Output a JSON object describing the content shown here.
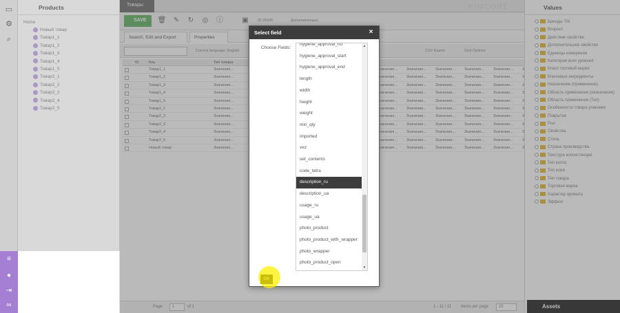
{
  "left_panel": {
    "title": "Products",
    "home": "Home",
    "items": [
      "Новый товар",
      "Товар1_1",
      "Товар1_2",
      "Товар1_3",
      "Товар1_4",
      "Товар1_5",
      "Товар2_1",
      "Товар2_2",
      "Товар2_3",
      "Товар2_4",
      "Товар2_5"
    ]
  },
  "tab": {
    "label": "Товары"
  },
  "toolbar": {
    "save_label": "SAVE",
    "id_text": "ID 25435",
    "variant_label": "Дополнительно"
  },
  "subtabs": {
    "search": "Search, Edit and Export",
    "properties": "Properties"
  },
  "grid_toolbar": {
    "language_label": "Current language: English",
    "csv_export": "CSV Export",
    "grid_options": "Grid Options"
  },
  "grid": {
    "headers": [
      "ID",
      "Key",
      "Тип товара"
    ],
    "rows": [
      {
        "key": "Товар1_1",
        "val": "Значение..."
      },
      {
        "key": "Товар1_2",
        "val": "Значение..."
      },
      {
        "key": "Товар1_3",
        "val": "Значение..."
      },
      {
        "key": "Товар1_4",
        "val": "Значение..."
      },
      {
        "key": "Товар1_5",
        "val": "Значение..."
      },
      {
        "key": "Товар2_1",
        "val": "Значение..."
      },
      {
        "key": "Товар2_2",
        "val": "Значение..."
      },
      {
        "key": "Товар2_3",
        "val": "Значение..."
      },
      {
        "key": "Товар2_4",
        "val": "Значение..."
      },
      {
        "key": "Товар2_5",
        "val": "Значение..."
      },
      {
        "key": "Новый товар",
        "val": "Значение..."
      }
    ]
  },
  "pager": {
    "page_label": "Page",
    "page_value": "1",
    "of_label": "of 1",
    "summary": "1 - 11 / 11",
    "items_per_page": "Items per page",
    "per_page_value": "25"
  },
  "right_panel": {
    "title": "Values",
    "items": [
      "Бренды ТМ",
      "Возраст",
      "Действие свойство",
      "Дополнительное свойство",
      "Единицы измерения",
      "Категории всех уровней",
      "Класс гостевой марки",
      "Ключевые ингредиенты",
      "Назначение (применение)",
      "Область применения (назначение)",
      "Область применения (Тип)",
      "Особенности товара упаковки",
      "Покрытие",
      "Пол",
      "Свойства",
      "Стиль",
      "Страна производства",
      "Текстура консистенция",
      "Тип волос",
      "Тип кожи",
      "Тип товара",
      "Торговая марка",
      "Характер аромата",
      "Эффект"
    ],
    "assets_label": "Assets"
  },
  "dialog": {
    "title": "Select field",
    "close": "×",
    "label": "Choose Fields:",
    "options": [
      "hygiene_approval_no",
      "hygiene_approval_start",
      "hygiene_approval_end",
      "length",
      "width",
      "height",
      "weight",
      "min_qty",
      "imported",
      "vez",
      "set_contents",
      "code_tetra",
      "description_ru",
      "description_ua",
      "usage_ru",
      "usage_ua",
      "photo_product",
      "photo_product_with_wrapper",
      "photo_wrapper",
      "photo_product_open"
    ],
    "selected": "description_ru",
    "ok_label": "OK"
  },
  "brand_watermark": "PIMCORE",
  "icons": {
    "save": "check-icon",
    "delete": "trash-icon",
    "edit": "pencil-icon",
    "reload": "reload-icon",
    "target": "target-icon",
    "info": "info-icon"
  }
}
